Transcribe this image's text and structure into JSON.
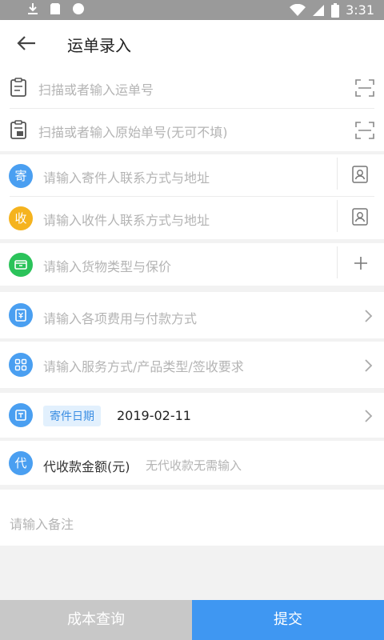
{
  "status_bar": {
    "time": "3:31",
    "icons": [
      "download-icon",
      "sd-card-icon",
      "circle-icon",
      "wifi-icon",
      "signal-icon",
      "battery-icon"
    ]
  },
  "header": {
    "title": "运单录入"
  },
  "waybill": {
    "waybill_placeholder": "扫描或者输入运单号",
    "original_placeholder": "扫描或者输入原始单号(无可不填)"
  },
  "sender": {
    "badge": "寄",
    "placeholder": "请输入寄件人联系方式与地址"
  },
  "receiver": {
    "badge": "收",
    "placeholder": "请输入收件人联系方式与地址"
  },
  "goods": {
    "placeholder": "请输入货物类型与保价"
  },
  "fees": {
    "placeholder": "请输入各项费用与付款方式"
  },
  "service": {
    "placeholder": "请输入服务方式/产品类型/签收要求"
  },
  "date": {
    "tag": "寄件日期",
    "value": "2019-02-11"
  },
  "cod": {
    "badge": "代",
    "label": "代收款金额(元)",
    "hint": "无代收款无需输入"
  },
  "remark": {
    "placeholder": "请输入备注"
  },
  "footer": {
    "cost_label": "成本查询",
    "submit_label": "提交"
  },
  "colors": {
    "accent": "#3f97f2",
    "sender_badge": "#4a9ff1",
    "receiver_badge": "#f5b31e",
    "goods_badge": "#2bc35a",
    "disabled_button": "#c8c8c8"
  }
}
